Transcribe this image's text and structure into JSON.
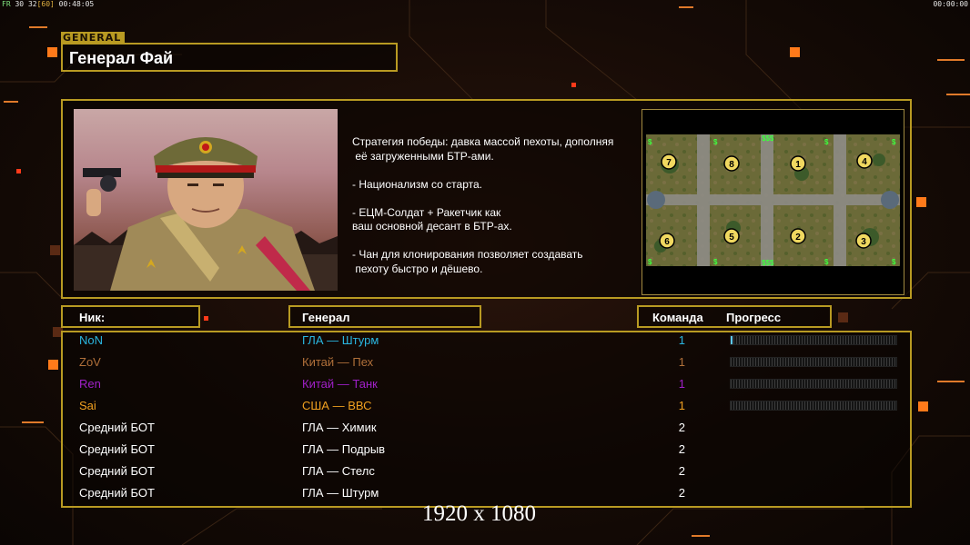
{
  "hud": {
    "fps_label": "FR",
    "fps_value": "30",
    "fps_extra": "32",
    "fps_cap": "[60]",
    "clock": "00:48:05",
    "right_clock": "00:00:00"
  },
  "general": {
    "tag": "GENERAL",
    "name": "Генерал Фай",
    "strategy": "Стратегия победы: давка массой пехоты, дополняя\n её загруженными БТР-ами.\n\n- Национализм со старта.\n\n- ЕЦМ-Солдат + Ракетчик как\nваш основной десант в БТР-ах.\n\n- Чан для клонирования позволяет создавать\n пехоту быстро и дёшево.",
    "portrait_icon": "general-portrait-icon",
    "map_icon": "minimap-icon",
    "map_slots": [
      "7",
      "8",
      "1",
      "4",
      "6",
      "5",
      "2",
      "3"
    ],
    "map_money": [
      "$$$",
      "$$$"
    ]
  },
  "table": {
    "headers": {
      "nick": "Ник:",
      "general": "Генерал",
      "team": "Команда",
      "progress": "Прогресс"
    },
    "rows": [
      {
        "nick": "NoN",
        "general": "ГЛА — Штурм",
        "team": "1",
        "color": "#2ab6e0",
        "progress": 0.01
      },
      {
        "nick": "ZoV",
        "general": "Китай — Пех",
        "team": "1",
        "color": "#b0703a",
        "progress": 0
      },
      {
        "nick": "Ren",
        "general": "Китай — Танк",
        "team": "1",
        "color": "#a020c8",
        "progress": 0
      },
      {
        "nick": "Sai",
        "general": "США — ВВС",
        "team": "1",
        "color": "#f0a020",
        "progress": 0
      },
      {
        "nick": "Средний БОТ",
        "general": "ГЛА — Химик",
        "team": "2",
        "color": "#ffffff",
        "progress": null
      },
      {
        "nick": "Средний БОТ",
        "general": "ГЛА — Подрыв",
        "team": "2",
        "color": "#ffffff",
        "progress": null
      },
      {
        "nick": "Средний БОТ",
        "general": "ГЛА — Стелс",
        "team": "2",
        "color": "#ffffff",
        "progress": null
      },
      {
        "nick": "Средний БОТ",
        "general": "ГЛА — Штурм",
        "team": "2",
        "color": "#ffffff",
        "progress": null
      }
    ]
  },
  "resolution": "1920 x 1080",
  "colors": {
    "frame": "#b89a22",
    "accent": "#ff7a1a"
  }
}
